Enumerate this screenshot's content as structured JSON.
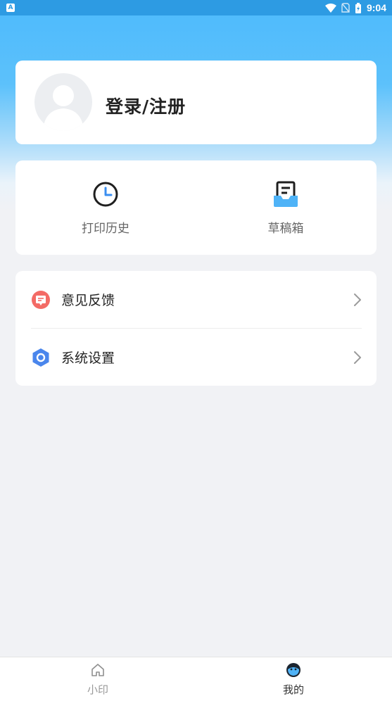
{
  "status_bar": {
    "time": "9:04",
    "app_icon_letter": "A"
  },
  "profile": {
    "login_label": "登录/注册"
  },
  "shortcuts": [
    {
      "label": "打印历史",
      "icon": "clock-icon"
    },
    {
      "label": "草稿箱",
      "icon": "drafts-tray-icon"
    }
  ],
  "menu": [
    {
      "label": "意见反馈",
      "icon": "feedback-icon",
      "color": "#f0625f"
    },
    {
      "label": "系统设置",
      "icon": "settings-hexagon-icon",
      "color": "#3f80ea"
    }
  ],
  "tabs": [
    {
      "label": "小印",
      "icon": "home-icon",
      "active": false
    },
    {
      "label": "我的",
      "icon": "profile-face-icon",
      "active": true
    }
  ],
  "colors": {
    "primary": "#4dbafc",
    "tab_active": "#333333",
    "tab_inactive": "#999999"
  }
}
